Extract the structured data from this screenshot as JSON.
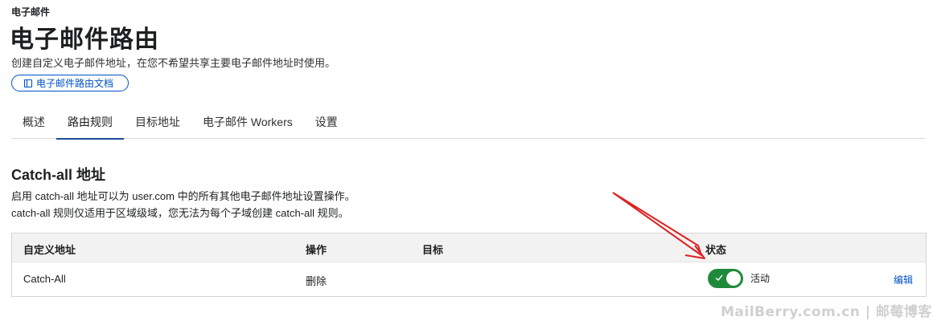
{
  "breadcrumb": "电子邮件",
  "page": {
    "title": "电子邮件路由",
    "description": "创建自定义电子邮件地址，在您不希望共享主要电子邮件地址时使用。",
    "doc_link": "电子邮件路由文档"
  },
  "tabs": [
    {
      "label": "概述",
      "active": false
    },
    {
      "label": "路由规则",
      "active": true
    },
    {
      "label": "目标地址",
      "active": false
    },
    {
      "label": "电子邮件 Workers",
      "active": false
    },
    {
      "label": "设置",
      "active": false
    }
  ],
  "catch_all": {
    "title": "Catch-all 地址",
    "desc_line1": "启用 catch-all 地址可以为 user.com 中的所有其他电子邮件地址设置操作。",
    "desc_line2": "catch-all 规则仅适用于区域级域，您无法为每个子域创建 catch-all 规则。"
  },
  "table": {
    "headers": {
      "address": "自定义地址",
      "action": "操作",
      "destination": "目标",
      "status": "状态"
    },
    "row": {
      "address": "Catch-All",
      "action": "删除",
      "destination": "",
      "status": "活动",
      "status_on": true,
      "edit": "编辑"
    }
  },
  "watermark": "MailBerry.com.cn | 邮莓博客",
  "colors": {
    "accent": "#0051c3",
    "toggle_on": "#1f8a3b",
    "tab_underline": "#1a4b96",
    "annotation_arrow": "#e02020"
  }
}
